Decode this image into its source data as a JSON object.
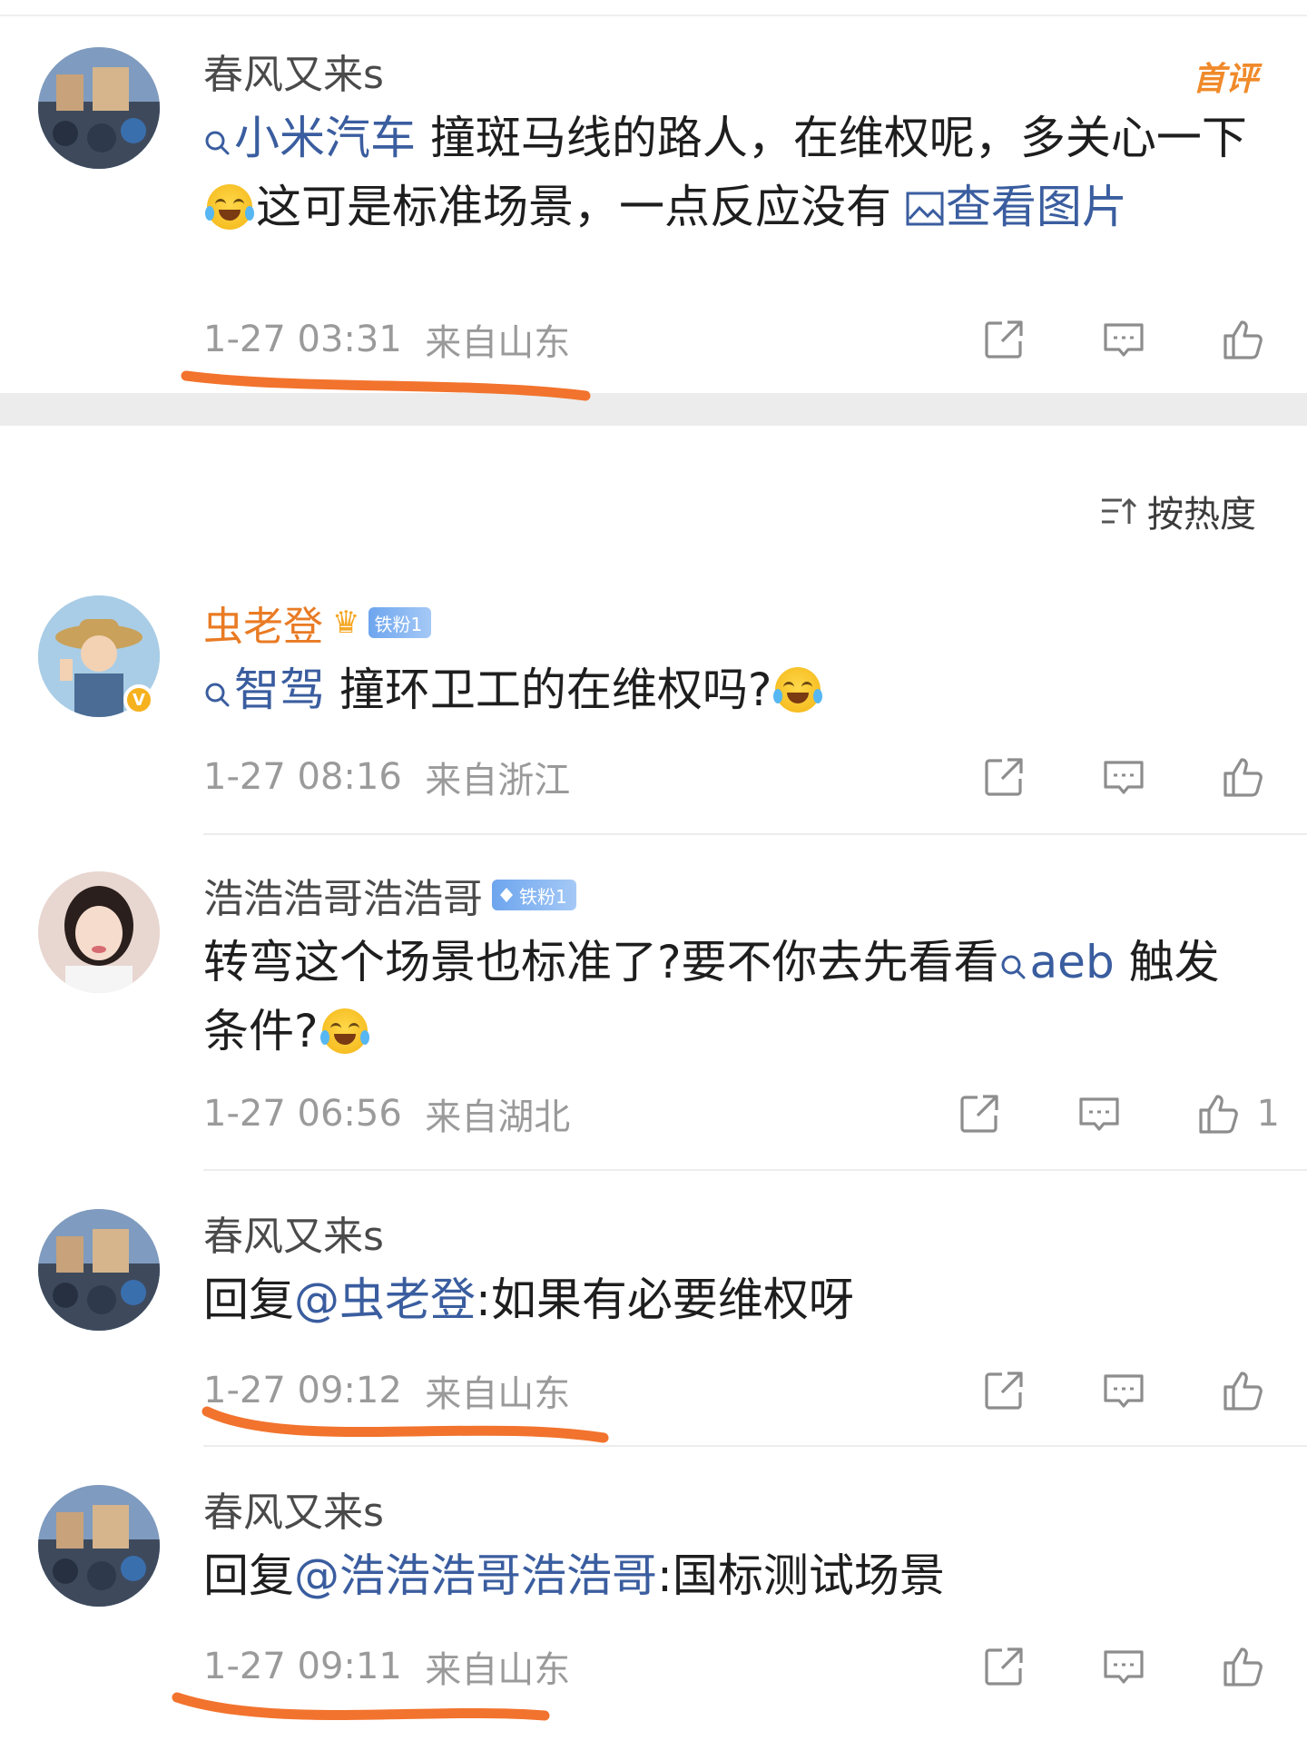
{
  "post": {
    "author": "春风又来s",
    "top_tag": "首评",
    "topic": "小米汽车",
    "text_before": " 撞斑马线的路人，在维权呢，多关心一下",
    "text_after": "这可是标准场景，一点反应没有 ",
    "image_link": "查看图片",
    "time": "1-27 03:31",
    "location": "来自山东"
  },
  "sort": {
    "label": "按热度"
  },
  "comments": [
    {
      "author": "虫老登",
      "fan_badge": "铁粉1",
      "topic": "智驾",
      "text": " 撞环卫工的在维权吗?",
      "time": "1-27 08:16",
      "location": "来自浙江",
      "verified": "V"
    },
    {
      "author": "浩浩浩哥浩浩哥",
      "fan_badge": "铁粉1",
      "text_before": "转弯这个场景也标准了?要不你去先看看",
      "topic": "aeb",
      "text_after": " 触发条件?",
      "time": "1-27 06:56",
      "location": "来自湖北",
      "likes": "1"
    },
    {
      "author": "春风又来s",
      "reply_prefix": "回复",
      "reply_to": "@虫老登",
      "text": ":如果有必要维权呀",
      "time": "1-27 09:12",
      "location": "来自山东"
    },
    {
      "author": "春风又来s",
      "reply_prefix": "回复",
      "reply_to": "@浩浩浩哥浩浩哥",
      "text": ":国标测试场景",
      "time": "1-27 09:11",
      "location": "来自山东"
    }
  ],
  "colors": {
    "link": "#3a5d9f",
    "orange_marker": "#f2732d",
    "name_orange": "#e97b24"
  },
  "icons": [
    "search-icon",
    "image-icon",
    "share-icon",
    "comment-icon",
    "like-icon",
    "sort-icon",
    "crown-icon",
    "diamond-icon",
    "laugh-cry-emoji"
  ]
}
